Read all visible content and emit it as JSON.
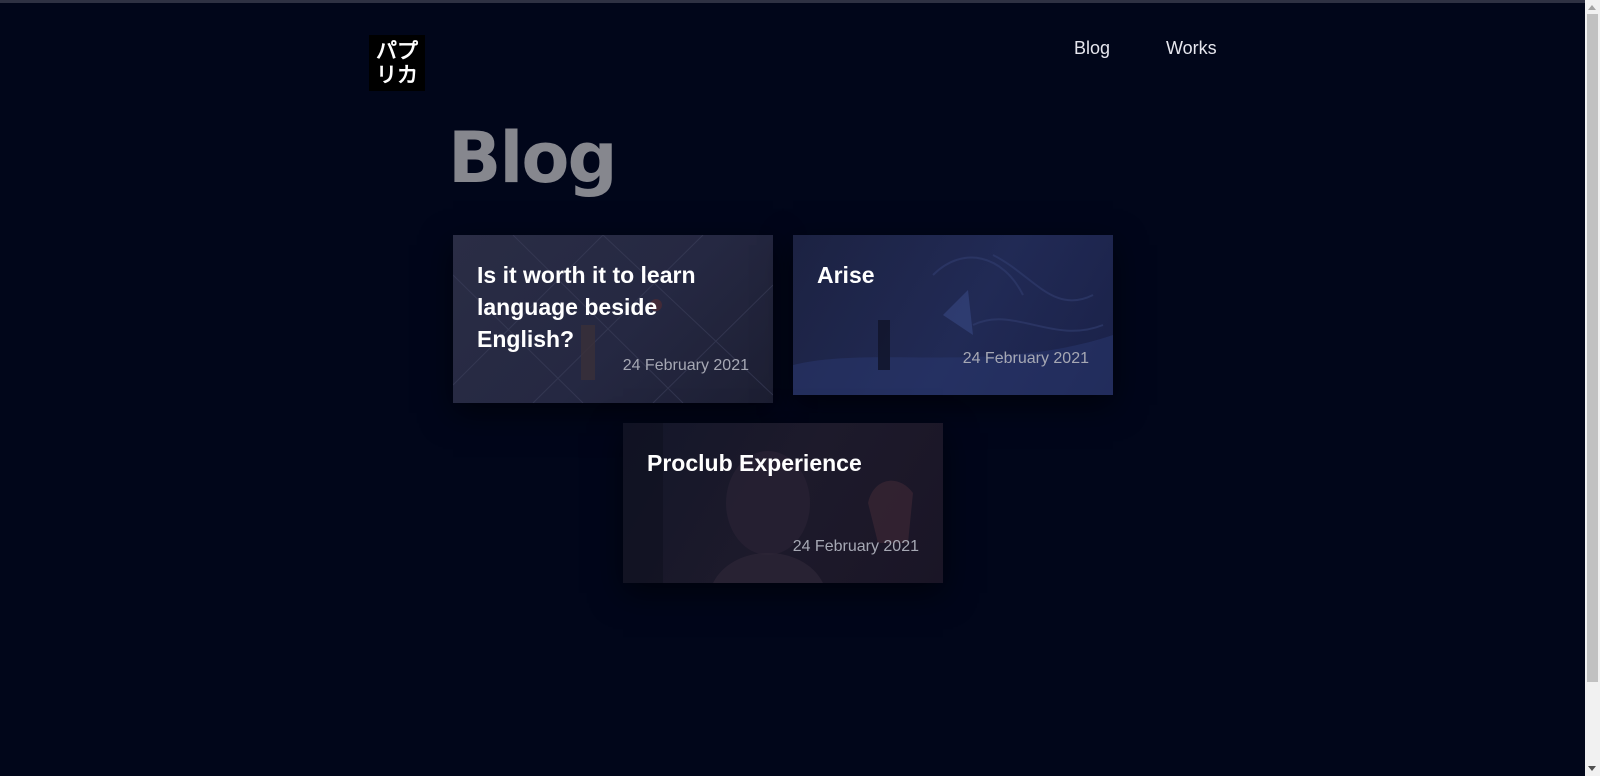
{
  "header": {
    "logo_line1": "パプ",
    "logo_line2": "リカ",
    "nav": [
      {
        "label": "Blog"
      },
      {
        "label": "Works"
      }
    ]
  },
  "main": {
    "title": "Blog",
    "posts": [
      {
        "title": "Is it worth it to learn language beside English?",
        "date": "24 February 2021"
      },
      {
        "title": "Arise",
        "date": "24 February 2021"
      },
      {
        "title": "Proclub Experience",
        "date": "24 February 2021"
      }
    ]
  },
  "colors": {
    "background": "#01061a",
    "title": "#86878e",
    "card_text": "#ffffff",
    "date_text": "#a6a8b4"
  }
}
